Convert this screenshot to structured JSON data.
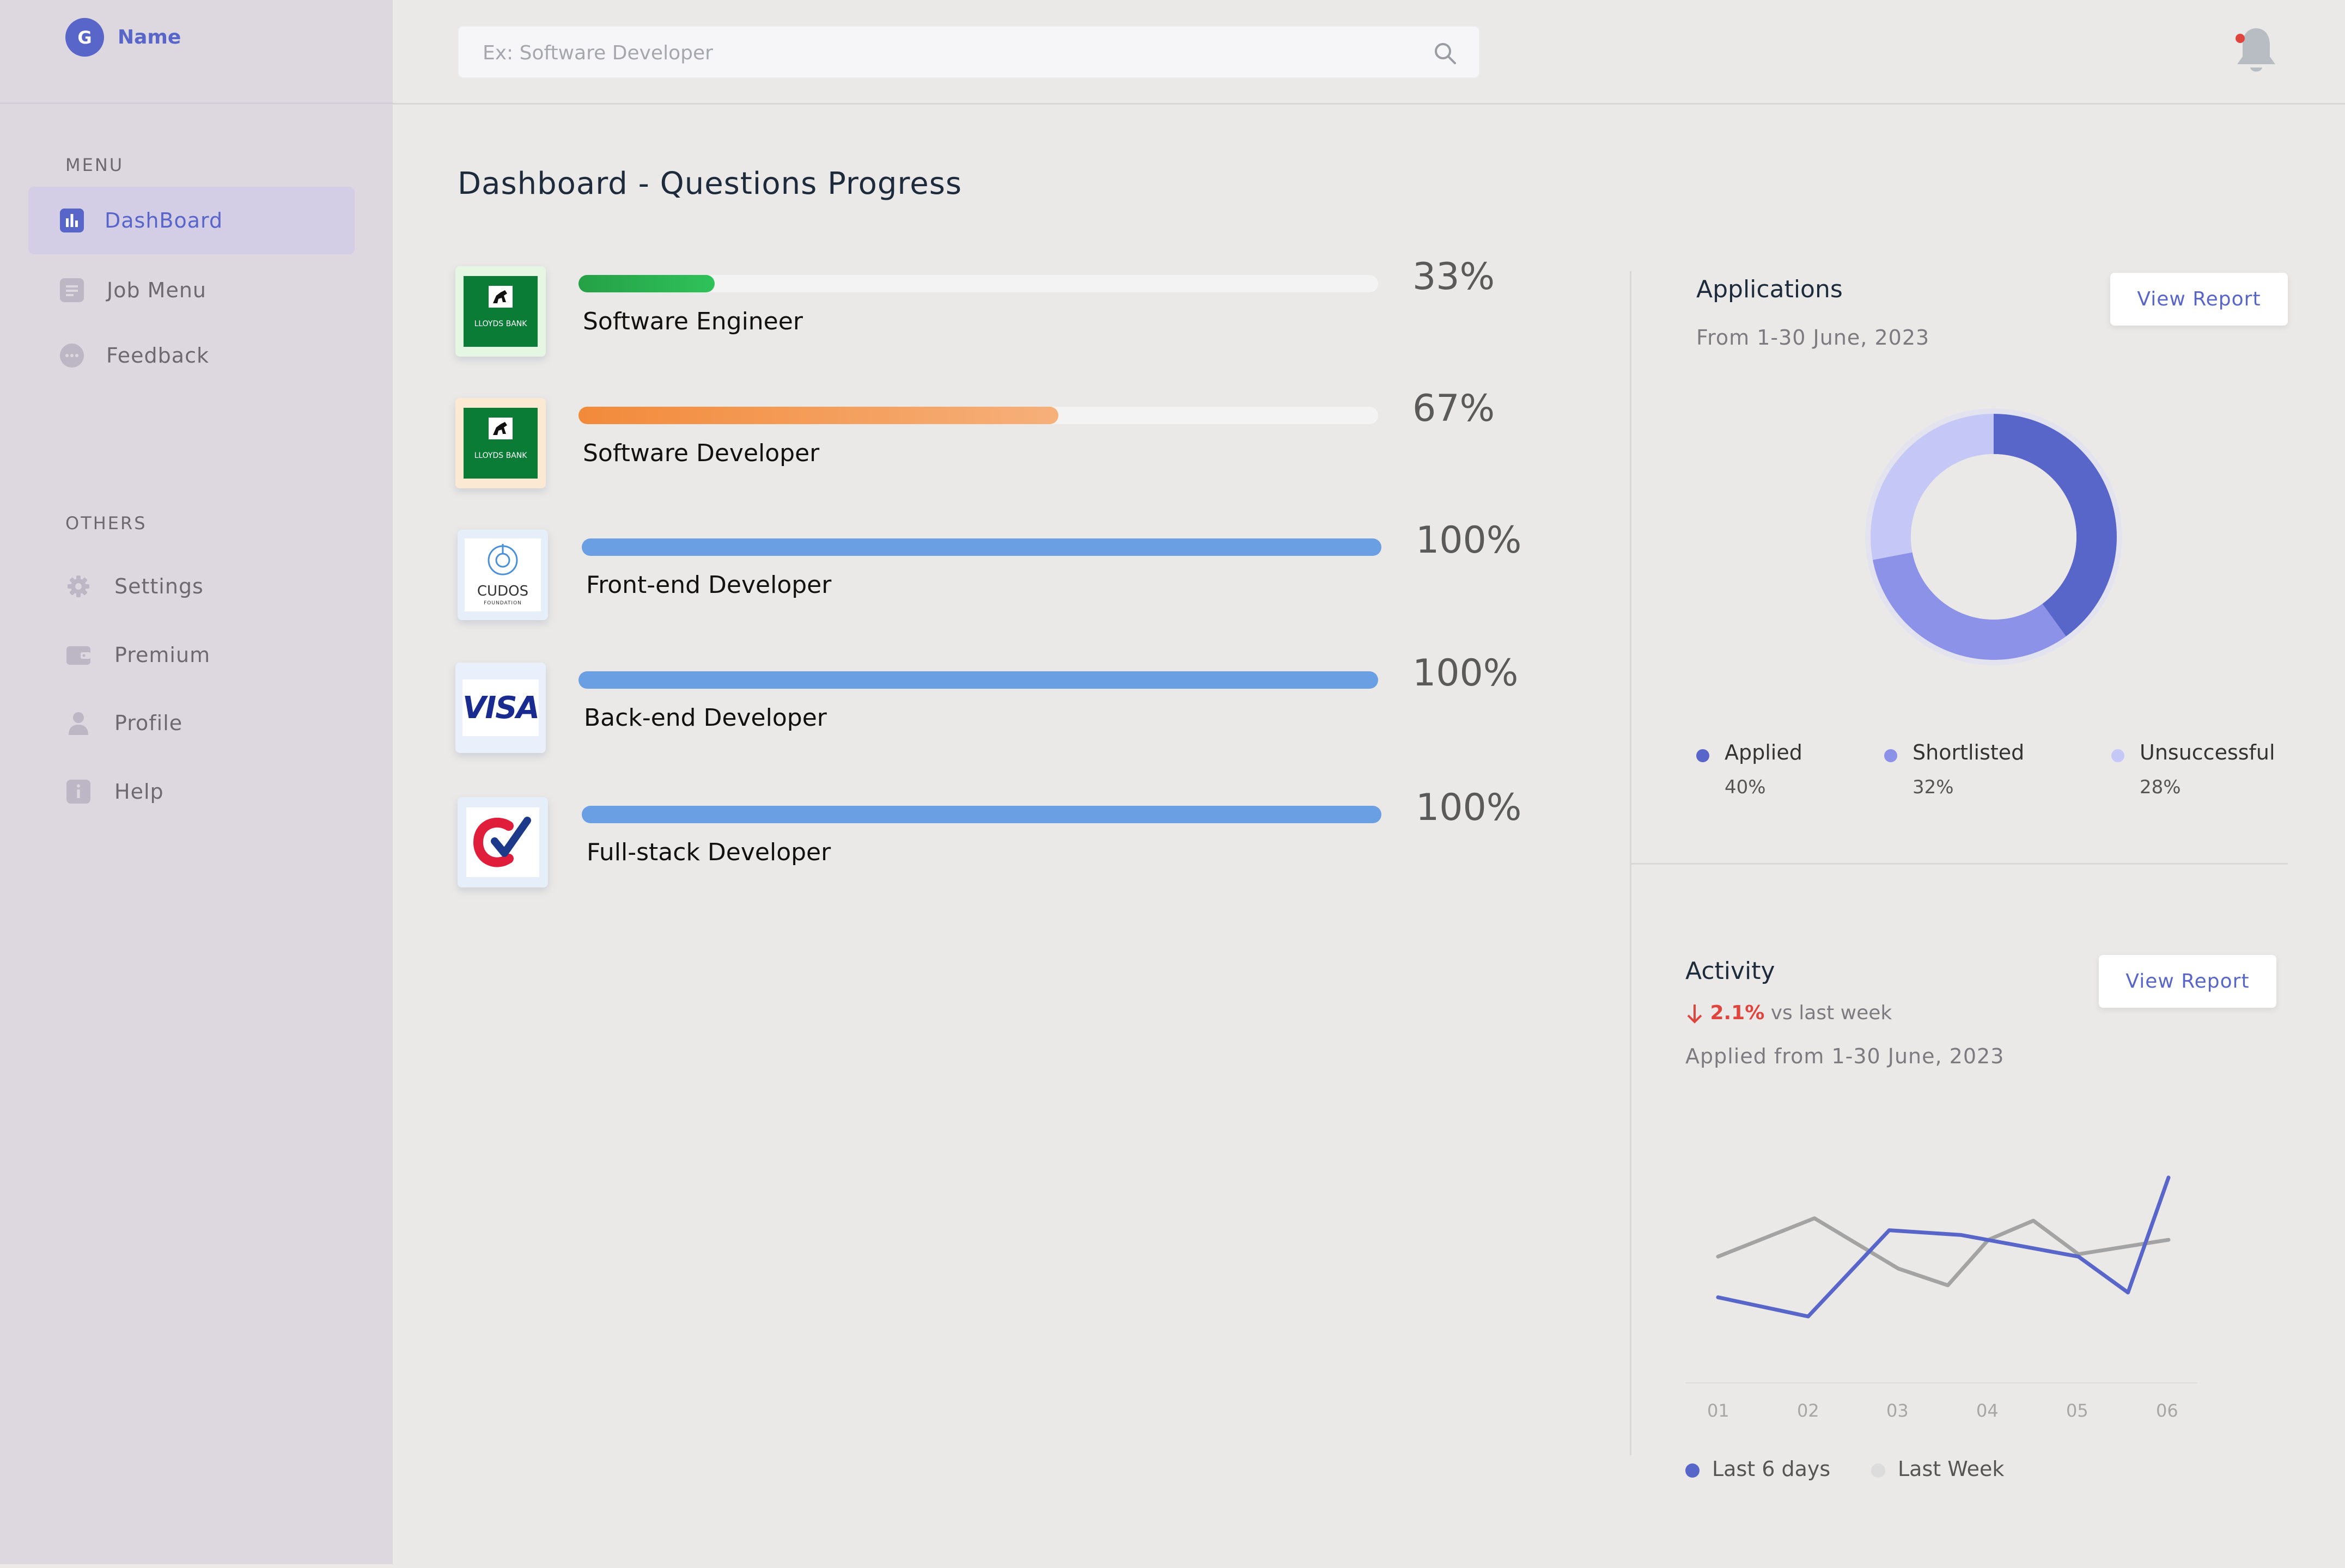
{
  "user": {
    "initial": "G",
    "name": "Name"
  },
  "sidebar": {
    "menu_label": "MENU",
    "others_label": "OTHERS",
    "menu_items": [
      {
        "label": "DashBoard",
        "icon": "bar-chart-icon",
        "active": true
      },
      {
        "label": "Job Menu",
        "icon": "document-icon"
      },
      {
        "label": "Feedback",
        "icon": "chat-bubble-icon"
      }
    ],
    "other_items": [
      {
        "label": "Settings",
        "icon": "gear-icon"
      },
      {
        "label": "Premium",
        "icon": "wallet-icon"
      },
      {
        "label": "Profile",
        "icon": "user-icon"
      },
      {
        "label": "Help",
        "icon": "info-icon"
      }
    ]
  },
  "search": {
    "placeholder": "Ex: Software Developer"
  },
  "page": {
    "title": "Dashboard - Questions Progress"
  },
  "progress": [
    {
      "title": "Software Engineer",
      "percent_label": "33%",
      "value": 0.17,
      "company_logo": "lloyds-bank-logo",
      "logo_text": "LLOYDS BANK",
      "color": "#2bb24c"
    },
    {
      "title": "Software Developer",
      "percent_label": "67%",
      "value": 0.6,
      "company_logo": "lloyds-bank-logo",
      "logo_text": "LLOYDS BANK",
      "color": "#f58e3c"
    },
    {
      "title": "Front-end Developer",
      "percent_label": "100%",
      "value": 1.0,
      "company_logo": "cudos-logo",
      "logo_text": "CUDOS",
      "logo_subtext": "FOUNDATION",
      "color": "#6b9fe3"
    },
    {
      "title": "Back-end Developer",
      "percent_label": "100%",
      "value": 1.0,
      "company_logo": "visa-logo",
      "logo_text": "VISA",
      "color": "#6b9fe3"
    },
    {
      "title": "Full-stack Developer",
      "percent_label": "100%",
      "value": 1.0,
      "company_logo": "checkmark-logo",
      "color": "#6b9fe3"
    }
  ],
  "applications": {
    "title": "Applications",
    "subtitle": "From 1-30 June, 2023",
    "button_label": "View Report",
    "legend": [
      {
        "name": "Applied",
        "percent": "40%",
        "value": 40,
        "color": "#5865c9"
      },
      {
        "name": "Shortlisted",
        "percent": "32%",
        "value": 32,
        "color": "#8b92e8"
      },
      {
        "name": "Unsuccessful",
        "percent": "28%",
        "value": 28,
        "color": "#c5c8f7"
      }
    ]
  },
  "activity": {
    "title": "Activity",
    "delta_value": "2.1%",
    "delta_text": "vs last week",
    "subtitle": "Applied from 1-30 June, 2023",
    "button_label": "View Report"
  },
  "chart_data": {
    "type": "line",
    "x": [
      "01",
      "02",
      "03",
      "04",
      "05",
      "06"
    ],
    "ylim": [
      0,
      100
    ],
    "grid": false,
    "legend_position": "bottom-left",
    "series": [
      {
        "name": "Last 6 days",
        "color": "#5865c9",
        "x": [
          1,
          2,
          2.9,
          3.7,
          5,
          5.55,
          6
        ],
        "values": [
          38,
          30,
          66,
          64,
          55,
          40,
          88
        ]
      },
      {
        "name": "Last Week",
        "color": "#a3a3a3",
        "x": [
          1,
          2.07,
          3,
          3.55,
          4,
          4.5,
          5,
          6
        ],
        "values": [
          55,
          71,
          50,
          43,
          62,
          70,
          56,
          62
        ]
      }
    ]
  },
  "colors": {
    "accent": "#5865c9",
    "negative": "#e0453d",
    "notification_dot": "#e0453d"
  }
}
